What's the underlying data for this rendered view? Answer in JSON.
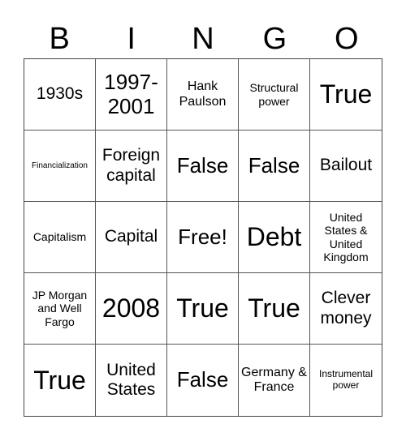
{
  "header": {
    "letters": [
      "B",
      "I",
      "N",
      "G",
      "O"
    ]
  },
  "cells": [
    {
      "text": "1930s",
      "size": "md"
    },
    {
      "text": "1997-2001",
      "size": "lg"
    },
    {
      "text": "Hank Paulson",
      "size": "sm"
    },
    {
      "text": "Structural power",
      "size": "xs"
    },
    {
      "text": "True",
      "size": "xl"
    },
    {
      "text": "Financialization",
      "size": "tiny"
    },
    {
      "text": "Foreign capital",
      "size": "md"
    },
    {
      "text": "False",
      "size": "lg"
    },
    {
      "text": "False",
      "size": "lg"
    },
    {
      "text": "Bailout",
      "size": "md"
    },
    {
      "text": "Capitalism",
      "size": "xs"
    },
    {
      "text": "Capital",
      "size": "md"
    },
    {
      "text": "Free!",
      "size": "lg"
    },
    {
      "text": "Debt",
      "size": "xl"
    },
    {
      "text": "United States & United Kingdom",
      "size": "xs"
    },
    {
      "text": "JP Morgan and Well Fargo",
      "size": "xs"
    },
    {
      "text": "2008",
      "size": "xl"
    },
    {
      "text": "True",
      "size": "xl"
    },
    {
      "text": "True",
      "size": "xl"
    },
    {
      "text": "Clever money",
      "size": "md"
    },
    {
      "text": "True",
      "size": "xl"
    },
    {
      "text": "United States",
      "size": "md"
    },
    {
      "text": "False",
      "size": "lg"
    },
    {
      "text": "Germany & France",
      "size": "sm"
    },
    {
      "text": "Instrumental power",
      "size": "xxs"
    }
  ]
}
